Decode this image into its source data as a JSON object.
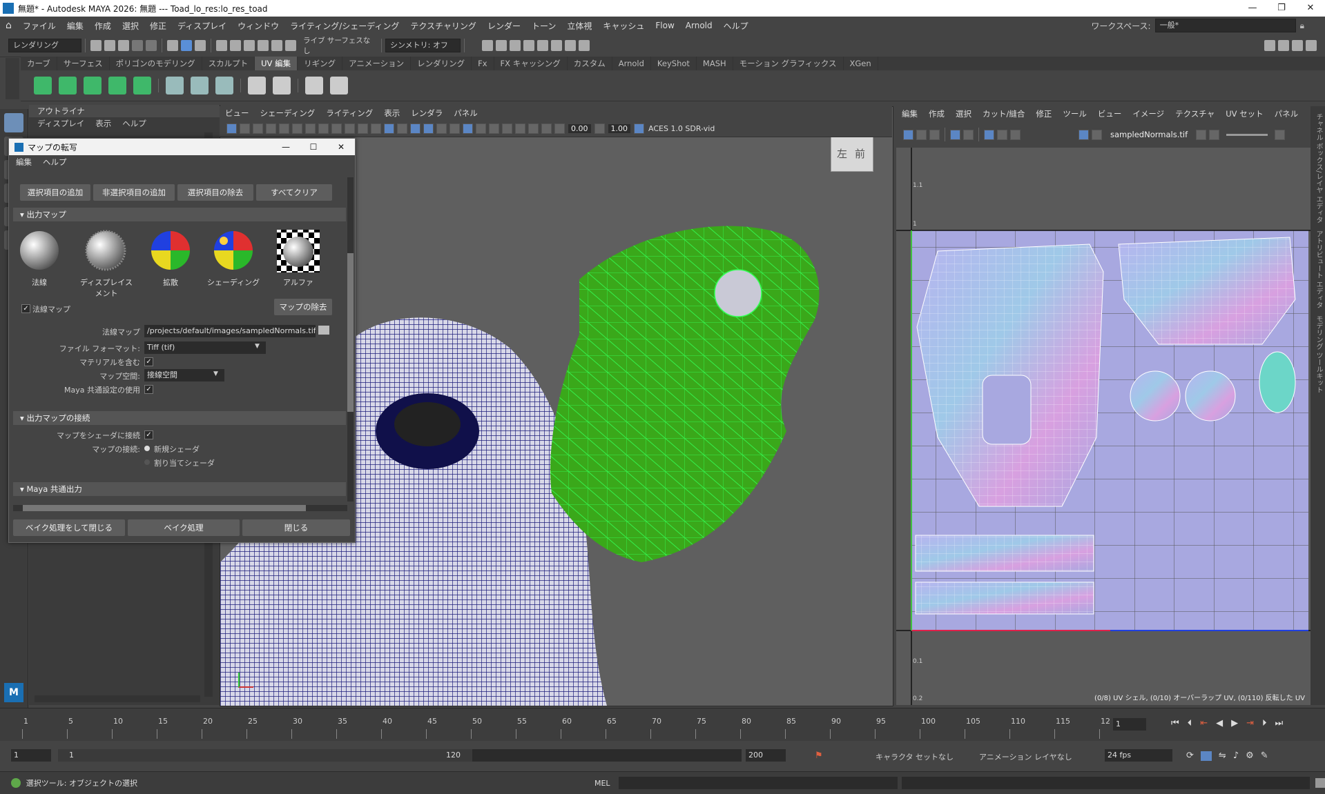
{
  "window": {
    "title": "無題* - Autodesk MAYA 2026: 無題   ---   Toad_lo_res:lo_res_toad"
  },
  "menubar": {
    "items": [
      "ファイル",
      "編集",
      "作成",
      "選択",
      "修正",
      "ディスプレイ",
      "ウィンドウ",
      "ライティング/シェーディング",
      "テクスチャリング",
      "レンダー",
      "トーン",
      "立体視",
      "キャッシュ",
      "Flow",
      "Arnold",
      "ヘルプ"
    ],
    "workspace_label": "ワークスペース:",
    "workspace_value": "一般*"
  },
  "statusline": {
    "mode": "レンダリング",
    "live_surface": "ライブ サーフェスなし",
    "symmetry": "シンメトリ: オフ"
  },
  "shelf": {
    "tabs": [
      "カーブ",
      "サーフェス",
      "ポリゴンのモデリング",
      "スカルプト",
      "UV 編集",
      "リギング",
      "アニメーション",
      "レンダリング",
      "Fx",
      "FX キャッシング",
      "カスタム",
      "Arnold",
      "KeyShot",
      "MASH",
      "モーション グラフィックス",
      "XGen"
    ],
    "active_tab": "UV 編集"
  },
  "outliner": {
    "title": "アウトライナ",
    "menu": [
      "ディスプレイ",
      "表示",
      "ヘルプ"
    ]
  },
  "viewport": {
    "menu": [
      "ビュー",
      "シェーディング",
      "ライティング",
      "表示",
      "レンダラ",
      "パネル"
    ],
    "exposure": "0.00",
    "gamma": "1.00",
    "color_space": "ACES 1.0 SDR-vid",
    "viewcube": {
      "left": "左",
      "front": "前"
    }
  },
  "uv_editor": {
    "menu": [
      "編集",
      "作成",
      "選択",
      "カット/縫合",
      "修正",
      "ツール",
      "ビュー",
      "イメージ",
      "テクスチャ",
      "UV セット",
      "パネル"
    ],
    "texture": "sampledNormals.tif",
    "status": "(0/8) UV シェル, (0/10) オーバーラップ UV, (0/110) 反転した UV",
    "axis_labels": [
      "1.1",
      "1",
      "0.1",
      "0.2"
    ]
  },
  "right_rail": {
    "labels": [
      "チャネル ボックス/レイヤ エディタ",
      "アトリビュート エディタ",
      "モデリング ツールキット"
    ]
  },
  "dialog": {
    "title": "マップの転写",
    "menu": [
      "編集",
      "ヘルプ"
    ],
    "top_buttons": [
      "選択項目の追加",
      "非選択項目の追加",
      "選択項目の除去",
      "すべてクリア"
    ],
    "section_output": "出力マップ",
    "maps": [
      "法線",
      "ディスプレイスメント",
      "拡散",
      "シェーディング",
      "アルファ"
    ],
    "normal_map_check": "法線マップ",
    "remove_map": "マップの除去",
    "normal_map_label": "法線マップ",
    "normal_map_path": "/projects/default/images/sampledNormals.tif",
    "file_format_label": "ファイル フォーマット:",
    "file_format_value": "Tiff (tif)",
    "include_material_label": "マテリアルを含む",
    "map_space_label": "マップ空間:",
    "map_space_value": "接線空間",
    "use_maya_common_label": "Maya 共通設定の使用",
    "section_connect": "出力マップの接続",
    "connect_to_shader_label": "マップをシェーダに接続",
    "map_connect_label": "マップの接続:",
    "radio_new": "新規シェーダ",
    "radio_assigned": "割り当てシェーダ",
    "section_common": "Maya 共通出力",
    "bottom_buttons": [
      "ベイク処理をして閉じる",
      "ベイク処理",
      "閉じる"
    ]
  },
  "timeline": {
    "ticks": [
      "1",
      "5",
      "10",
      "15",
      "20",
      "25",
      "30",
      "35",
      "40",
      "45",
      "50",
      "55",
      "60",
      "65",
      "70",
      "75",
      "80",
      "85",
      "90",
      "95",
      "100",
      "105",
      "110",
      "115",
      "12"
    ],
    "current_frame": "1"
  },
  "range": {
    "start": "1",
    "inner_start": "1",
    "inner_end": "120",
    "end": "200",
    "character": "キャラクタ セットなし",
    "anim_layer": "アニメーション レイヤなし",
    "fps": "24 fps"
  },
  "helpline": {
    "text": "選択ツール: オブジェクトの選択",
    "mel": "MEL"
  },
  "colors": {
    "mesh_blue": "#1c1c7a",
    "green_head": "#3aa81a",
    "wire_green": "#33ff55",
    "uv_bg": "#a8a8e0"
  }
}
